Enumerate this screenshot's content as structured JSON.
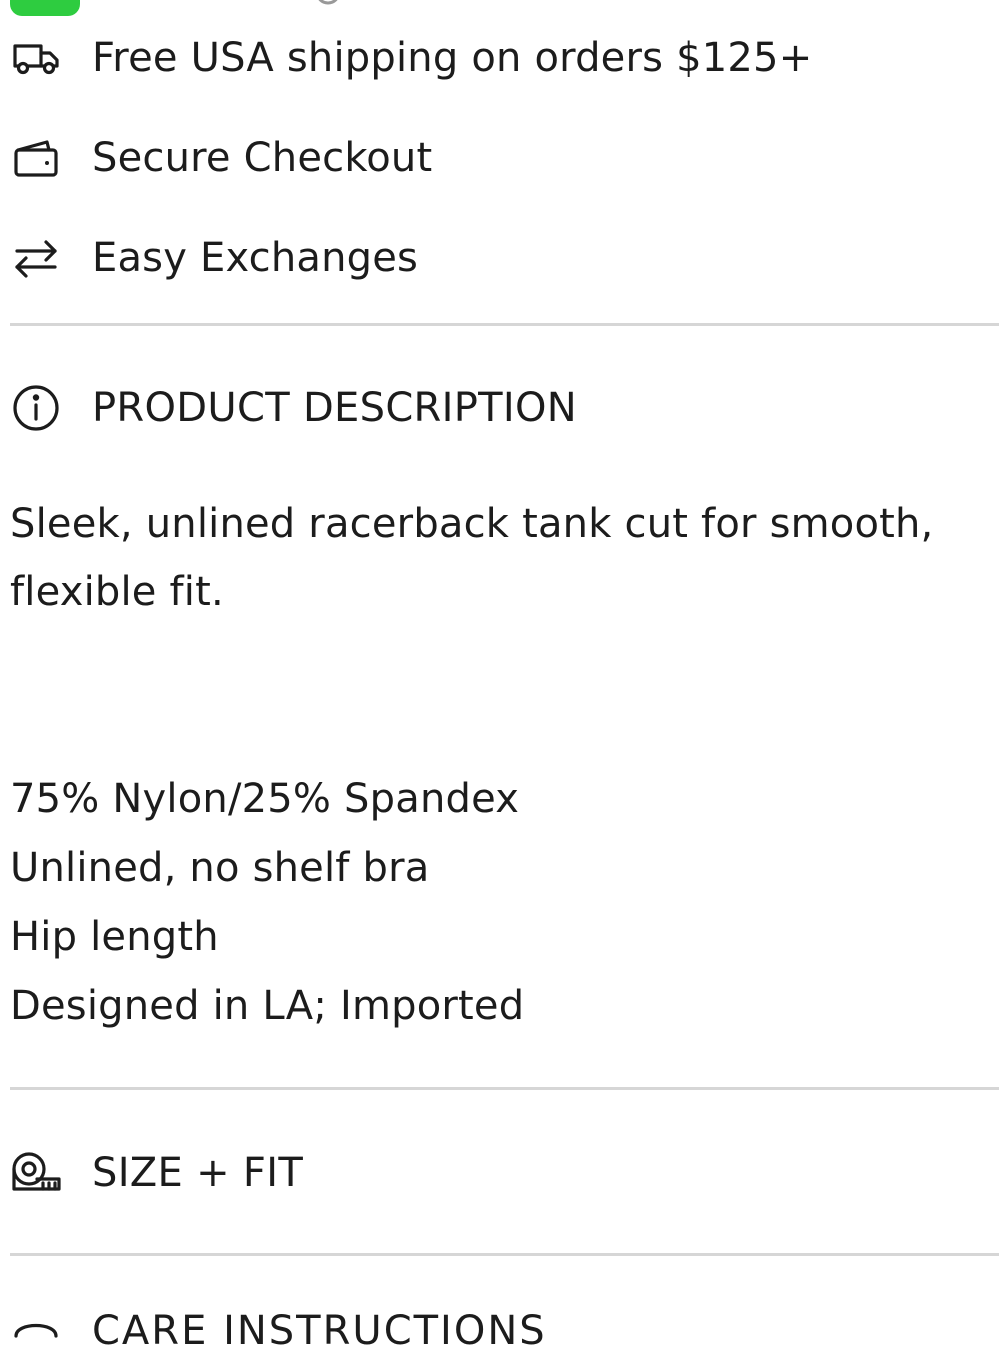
{
  "features": [
    {
      "icon": "truck-icon",
      "label": "Free USA shipping on orders $125+"
    },
    {
      "icon": "wallet-icon",
      "label": "Secure Checkout"
    },
    {
      "icon": "exchange-arrows-icon",
      "label": "Easy Exchanges"
    }
  ],
  "product_description": {
    "icon": "info-icon",
    "title": "PRODUCT DESCRIPTION",
    "text": "Sleek, unlined racerback tank cut for smooth, flexible fit.",
    "specs": [
      "75% Nylon/25% Spandex",
      "Unlined, no shelf bra",
      "Hip length",
      "Designed in LA; Imported"
    ]
  },
  "size_fit": {
    "icon": "measuring-tape-icon",
    "title": "SIZE + FIT"
  },
  "care_instructions": {
    "icon": "care-icon",
    "title": "CARE INSTRUCTIONS"
  },
  "colors": {
    "accent_green": "#2ecc40",
    "divider": "#d6d6d6",
    "text": "#1c1c1c"
  }
}
